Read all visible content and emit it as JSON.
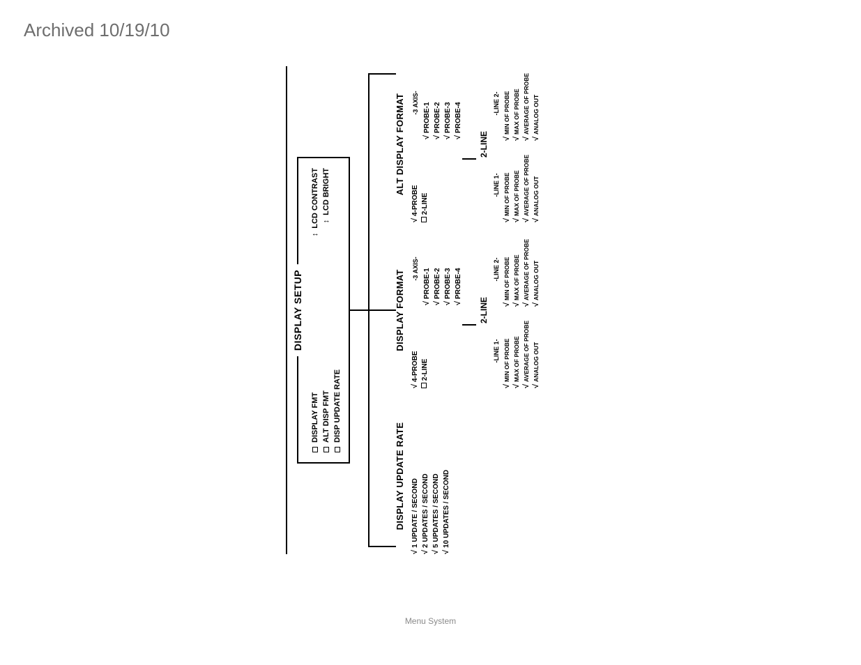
{
  "archived": "Archived 10/19/10",
  "footer": "Menu System",
  "root": {
    "title": "DISPLAY SETUP",
    "items": {
      "display_fmt": "DISPLAY FMT",
      "lcd_contrast": "LCD CONTRAST",
      "alt_disp_fmt": "ALT DISP FMT",
      "lcd_bright": "LCD BRIGHT",
      "disp_update_rate": "DISP UPDATE RATE"
    }
  },
  "rate": {
    "title": "DISPLAY UPDATE RATE",
    "opts": [
      "1 UPDATE / SECOND",
      "2 UPDATES / SECOND",
      "5 UPDATES / SECOND",
      "10 UPDATES / SECOND"
    ]
  },
  "fmt": {
    "title": "DISPLAY FORMAT",
    "left": {
      "four_probe": "4-PROBE",
      "two_line": "2-LINE"
    },
    "right_header": "-3 AXIS-",
    "right": [
      "PROBE-1",
      "PROBE-2",
      "PROBE-3",
      "PROBE-4"
    ],
    "two_line_title": "2-LINE",
    "line1": "-LINE 1-",
    "line2": "-LINE 2-",
    "line_opts": [
      "MIN OF PROBE",
      "MAX OF PROBE",
      "AVERAGE OF PROBE",
      "ANALOG OUT"
    ]
  },
  "altfmt": {
    "title": "ALT DISPLAY FORMAT",
    "left": {
      "four_probe": "4-PROBE",
      "two_line": "2-LINE"
    },
    "right_header": "-3 AXIS-",
    "right": [
      "PROBE-1",
      "PROBE-2",
      "PROBE-3",
      "PROBE-4"
    ],
    "two_line_title": "2-LINE",
    "line1": "-LINE 1-",
    "line2": "-LINE 2-",
    "line_opts": [
      "MIN OF PROBE",
      "MAX OF PROBE",
      "AVERAGE OF PROBE",
      "ANALOG OUT"
    ]
  }
}
